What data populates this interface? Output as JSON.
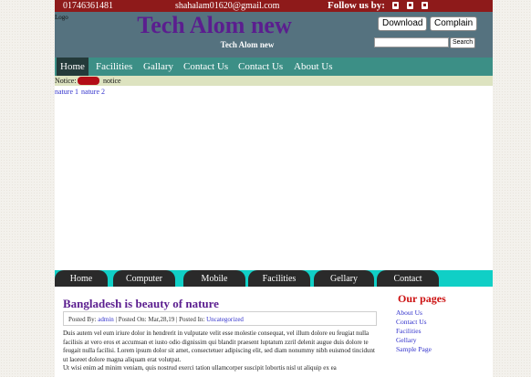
{
  "topbar": {
    "phone": "01746361481",
    "email": "shahalam01620@gmail.com",
    "follow_label": "Follow us by:"
  },
  "header": {
    "logo_text": "Logo",
    "title": "Tech Alom new",
    "tagline": "Tech Alom new",
    "download_label": "Download",
    "complain_label": "Complain",
    "search_button_label": "Search",
    "search_value": ""
  },
  "nav": {
    "items": [
      "Home",
      "Facilities",
      "Gallary",
      "Contact Us",
      "Contact Us",
      "About Us"
    ],
    "active_index": 0
  },
  "notice": {
    "label": "Notice:",
    "text": "notice"
  },
  "slider": {
    "links": [
      "nature 1",
      "nature 2"
    ]
  },
  "menu2": {
    "items": [
      "Home",
      "Computer",
      "Mobile",
      "Facilities",
      "Gellary",
      "Contact"
    ]
  },
  "post": {
    "title": "Bangladesh is beauty of nature",
    "posted_by_label": "Posted By:",
    "author": "admin",
    "posted_on": "| Posted On: Mar,28,19 | Posted In:",
    "category": "Uncategorized",
    "body": "Duis autem vel eum iriure dolor in hendrerit in vulputate velit esse molestie consequat, vel illum dolore eu feugiat nulla facilisis at vero eros et accumsan et iusto odio dignissim qui blandit praesent luptatum zzril delenit augue duis dolore te feugait nulla facilisi. Lorem ipsum dolor sit amet, consectetuer adipiscing elit, sed diam nonummy nibh euismod tincidunt ut laoreet dolore magna aliquam erat volutpat.",
    "body2": "Ut wisi enim ad minim veniam, quis nostrud exerci tation ullamcorper suscipit lobortis nisl ut aliquip ex ea"
  },
  "sidebar": {
    "title": "Our pages",
    "links": [
      "About Us",
      "Contact Us",
      "Facilities",
      "Gellary",
      "Sample Page"
    ]
  },
  "colors": {
    "topbar": "#8e1a1a",
    "header": "#55727f",
    "nav": "#3c8f86",
    "title": "#5b1e8f",
    "menu2_band": "#10cfc6",
    "sidebar_title": "#cc1111"
  }
}
